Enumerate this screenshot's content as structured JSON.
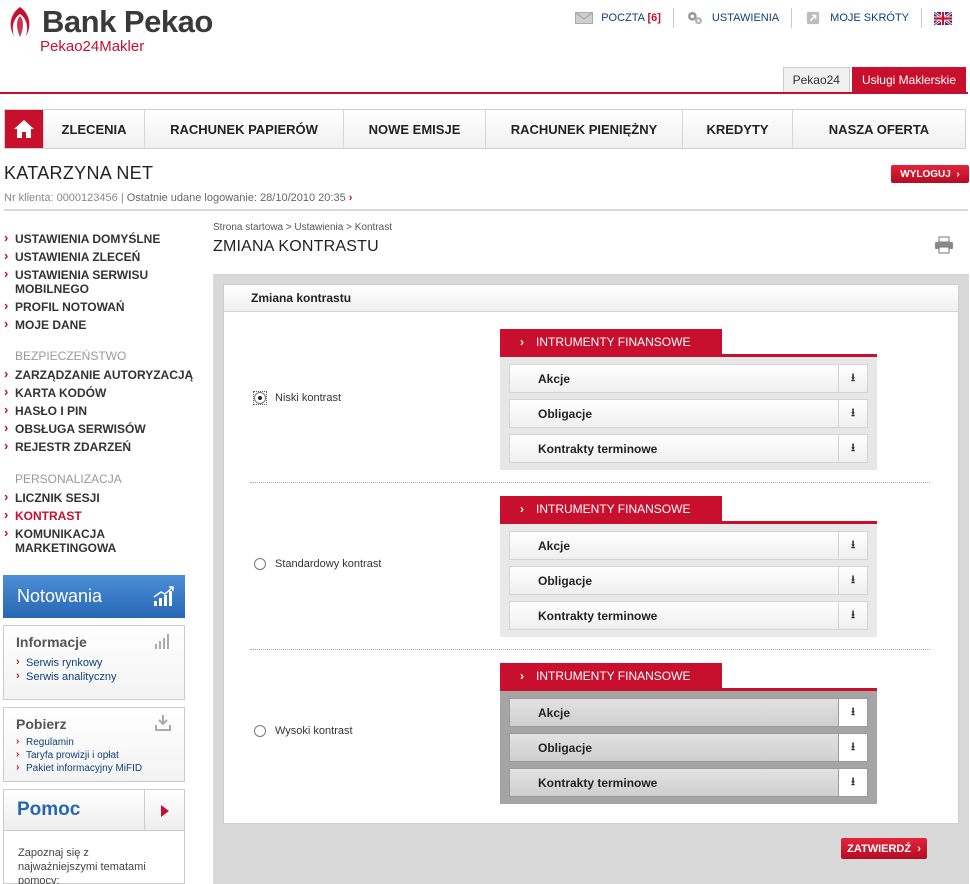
{
  "brand": {
    "name": "Bank Pekao",
    "sub": "Pekao24Makler"
  },
  "top_links": {
    "mail_label": "POCZTA",
    "mail_count": "[6]",
    "settings_label": "USTAWIENIA",
    "shortcuts_label": "MOJE SKRÓTY"
  },
  "tabs": [
    "Pekao24",
    "Usługi Maklerskie"
  ],
  "nav": [
    "ZLECENIA",
    "RACHUNEK PAPIERÓW",
    "NOWE EMISJE",
    "RACHUNEK PIENIĘŻNY",
    "KREDYTY",
    "NASZA OFERTA"
  ],
  "user": {
    "name": "KATARZYNA NET",
    "client_label": "Nr klienta: 0000123456",
    "sep": "|",
    "last_login_label": "Ostatnie udane logowanie:",
    "last_login_value": "28/10/2010 20:35",
    "arrow": "›",
    "logout": "WYLOGUJ"
  },
  "sidebar": {
    "group1": [
      "USTAWIENIA DOMYŚLNE",
      "USTAWIENIA ZLECEŃ",
      "USTAWIENIA SERWISU MOBILNEGO",
      "PROFIL NOTOWAŃ",
      "MOJE DANE"
    ],
    "security_head": "BEZPIECZEŃSTWO",
    "security": [
      "ZARZĄDZANIE AUTORYZACJĄ",
      "KARTA KODÓW",
      "HASŁO I PIN",
      "OBSŁUGA SERWISÓW",
      "REJESTR ZDARZEŃ"
    ],
    "personal_head": "PERSONALIZACJA",
    "personal": [
      "LICZNIK SESJI",
      "KONTRAST",
      "KOMUNIKACJA MARKETINGOWA"
    ],
    "active_item": "KONTRAST"
  },
  "widgets": {
    "quotes": "Notowania",
    "info_title": "Informacje",
    "info_links": [
      "Serwis rynkowy",
      "Serwis analityczny"
    ],
    "download_title": "Pobierz",
    "download_links": [
      "Regulamin",
      "Taryfa prowizji i opłat",
      "Pakiet informacyjny MiFID"
    ],
    "help_title": "Pomoc",
    "help_text": "Zapoznaj się z najważniejszymi tematami pomocy:"
  },
  "content": {
    "breadcrumb": "Strona startowa > Ustawienia > Kontrast",
    "title": "ZMIANA KONTRASTU",
    "panel_title": "Zmiana kontrastu",
    "options": [
      {
        "label": "Niski kontrast",
        "checked": true
      },
      {
        "label": "Standardowy kontrast",
        "checked": false
      },
      {
        "label": "Wysoki kontrast",
        "checked": false
      }
    ],
    "fin_tab": "INTRUMENTY FINANSOWE",
    "fin_items": [
      "Akcje",
      "Obligacje",
      "Kontrakty terminowe"
    ],
    "download_glyph": "⭳",
    "confirm": "ZATWIERDŹ"
  },
  "colors": {
    "brand_red": "#c8102e",
    "link_blue": "#0d3f7a",
    "quotes_blue": "#2766b4"
  }
}
